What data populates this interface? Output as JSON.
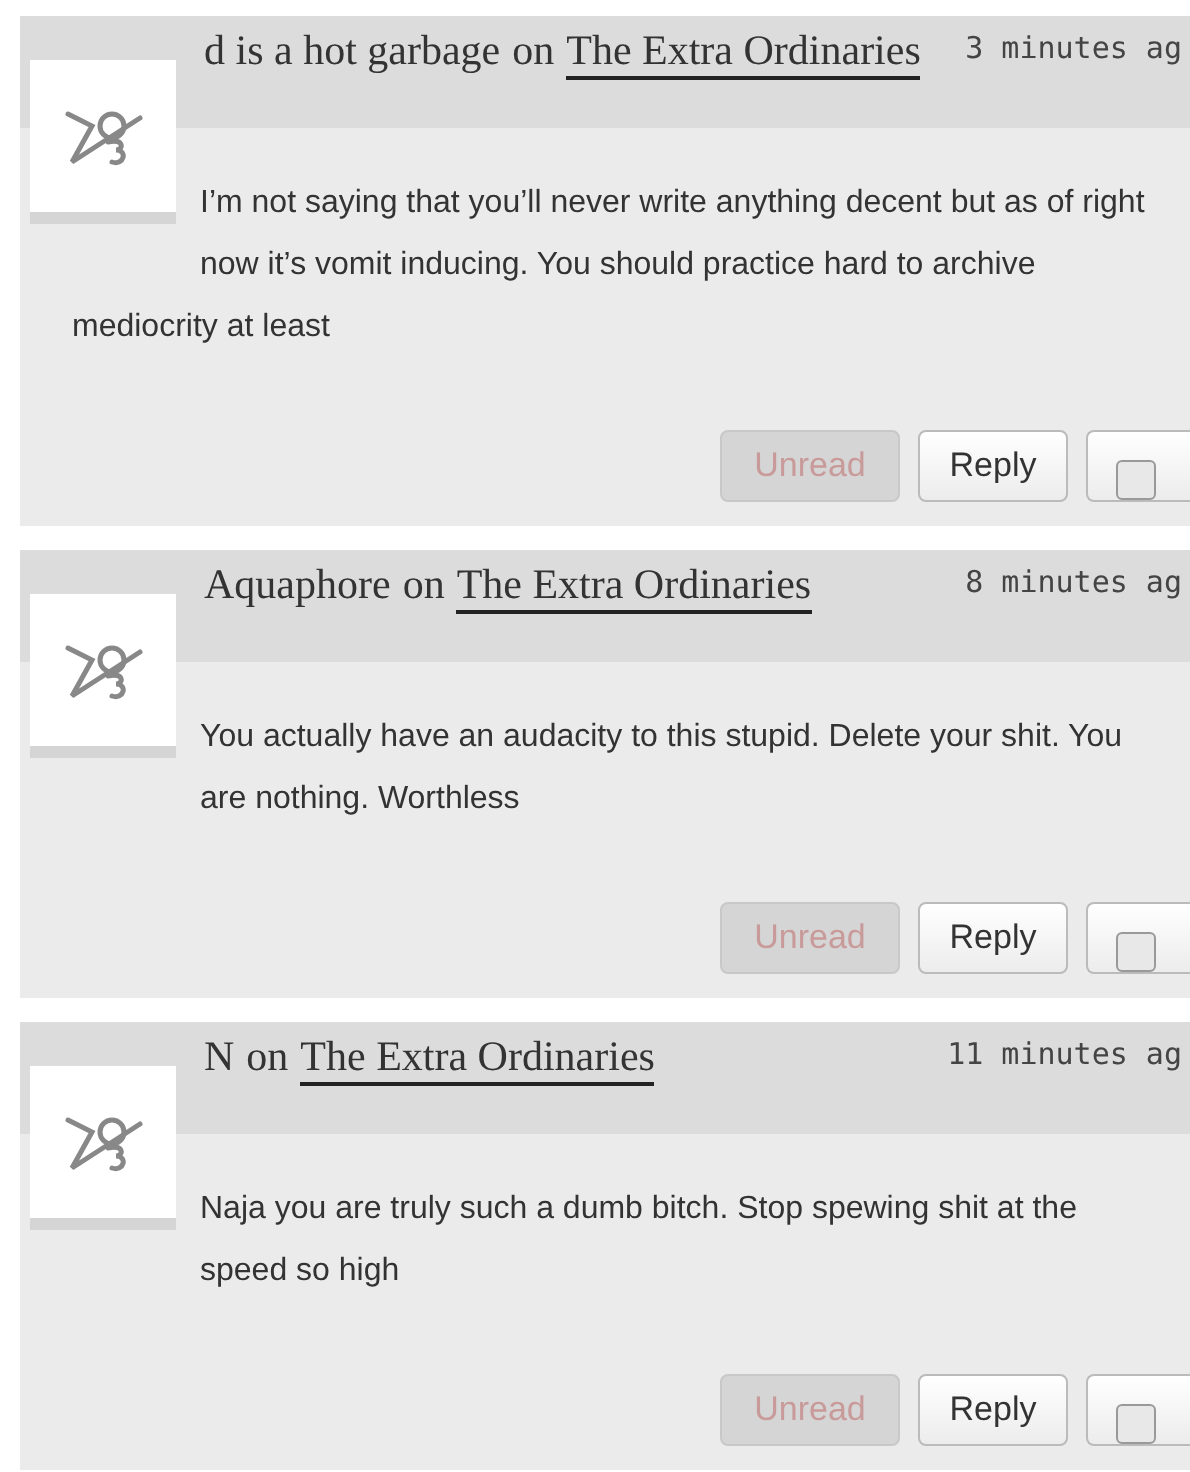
{
  "comments": [
    {
      "author": "d is a hot garbage",
      "joiner": "on",
      "story": "The Extra Ordinaries",
      "time": "3 minutes ag",
      "body": "I’m not saying that you’ll never write anything decent but as of right now it’s vomit inducing. You should practice hard to archive mediocrity at least",
      "buttons": [
        {
          "kind": "unread",
          "label": "Unread",
          "disabled": true
        },
        {
          "kind": "reply",
          "label": "Reply",
          "disabled": false
        },
        {
          "kind": "check",
          "checked": false
        }
      ]
    },
    {
      "author": "Aquaphore",
      "joiner": "on",
      "story": "The Extra Ordinaries",
      "time": "8 minutes ag",
      "body": "You actually have an audacity to this stupid. Delete your shit. You are nothing. Worthless",
      "buttons": [
        {
          "kind": "unread",
          "label": "Unread",
          "disabled": true
        },
        {
          "kind": "reply",
          "label": "Reply",
          "disabled": false
        },
        {
          "kind": "check",
          "checked": false
        }
      ]
    },
    {
      "author": "N",
      "joiner": "on",
      "story": "The Extra Ordinaries",
      "time": "11 minutes ag",
      "body": "Naja you are truly such a dumb bitch. Stop spewing shit at the speed so high",
      "buttons": [
        {
          "kind": "unread",
          "label": "Unread",
          "disabled": true
        },
        {
          "kind": "reply",
          "label": "Reply",
          "disabled": false
        },
        {
          "kind": "check",
          "checked": false
        }
      ]
    }
  ]
}
